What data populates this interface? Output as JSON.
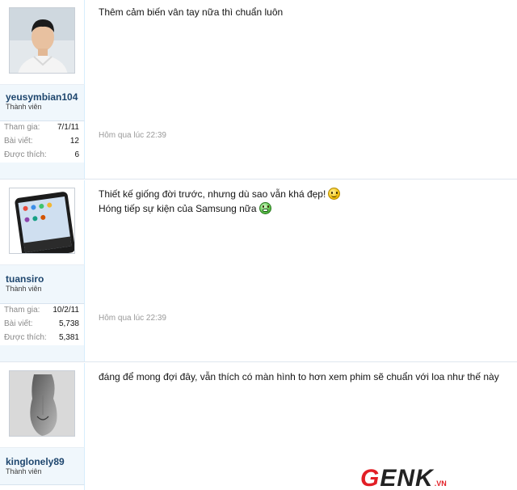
{
  "posts": [
    {
      "username": "yeusymbian104",
      "user_title": "Thành viên",
      "stats": [
        {
          "label": "Tham gia:",
          "value": "7/1/11"
        },
        {
          "label": "Bài viết:",
          "value": "12"
        },
        {
          "label": "Được thích:",
          "value": "6"
        }
      ],
      "message_lines": [
        "Thêm cảm biến vân tay nữa thì chuẩn luôn"
      ],
      "time": "Hôm qua lúc 22:39"
    },
    {
      "username": "tuansiro",
      "user_title": "Thành viên",
      "stats": [
        {
          "label": "Tham gia:",
          "value": "10/2/11"
        },
        {
          "label": "Bài viết:",
          "value": "5,738"
        },
        {
          "label": "Được thích:",
          "value": "5,381"
        }
      ],
      "message_lines": [
        "Thiết kế giống đời trước, nhưng dù sao vẫn khá đẹp!",
        "Hóng tiếp sự kiện của Samsung nữa"
      ],
      "time": "Hôm qua lúc 22:39"
    },
    {
      "username": "kinglonely89",
      "user_title": "Thành viên",
      "stats": [],
      "message_lines": [
        "đáng để mong đợi đây, vẫn thích có màn hình to hơn xem phim sẽ chuẩn với loa như thế này"
      ],
      "time": ""
    }
  ],
  "smileys": {
    "line1": "smile-emoji-icon",
    "line2": "grin-emoji-icon"
  },
  "watermark": {
    "brand_first": "G",
    "brand_rest": "ENK",
    "suffix": ".VN"
  },
  "colors": {
    "username": "#1e466e",
    "brand": "#e21f26",
    "sidebar_bg": "#f0f7fc"
  }
}
